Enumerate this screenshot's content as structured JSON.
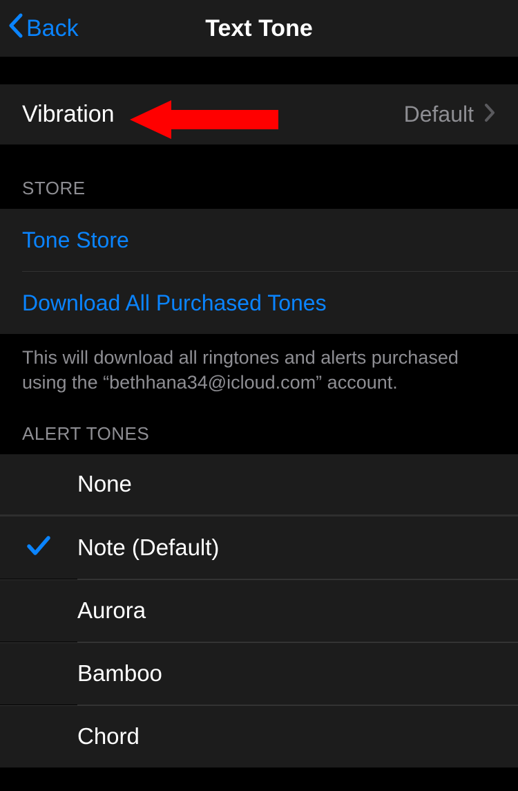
{
  "navbar": {
    "back_label": "Back",
    "title": "Text Tone"
  },
  "vibration": {
    "label": "Vibration",
    "value": "Default"
  },
  "store": {
    "header": "STORE",
    "tone_store": "Tone Store",
    "download_all": "Download All Purchased Tones",
    "footer": "This will download all ringtones and alerts purchased using the “bethhana34@icloud.com” account."
  },
  "alert_tones": {
    "header": "ALERT TONES",
    "items": [
      {
        "label": "None",
        "selected": false
      },
      {
        "label": "Note (Default)",
        "selected": true
      },
      {
        "label": "Aurora",
        "selected": false
      },
      {
        "label": "Bamboo",
        "selected": false
      },
      {
        "label": "Chord",
        "selected": false
      }
    ]
  }
}
